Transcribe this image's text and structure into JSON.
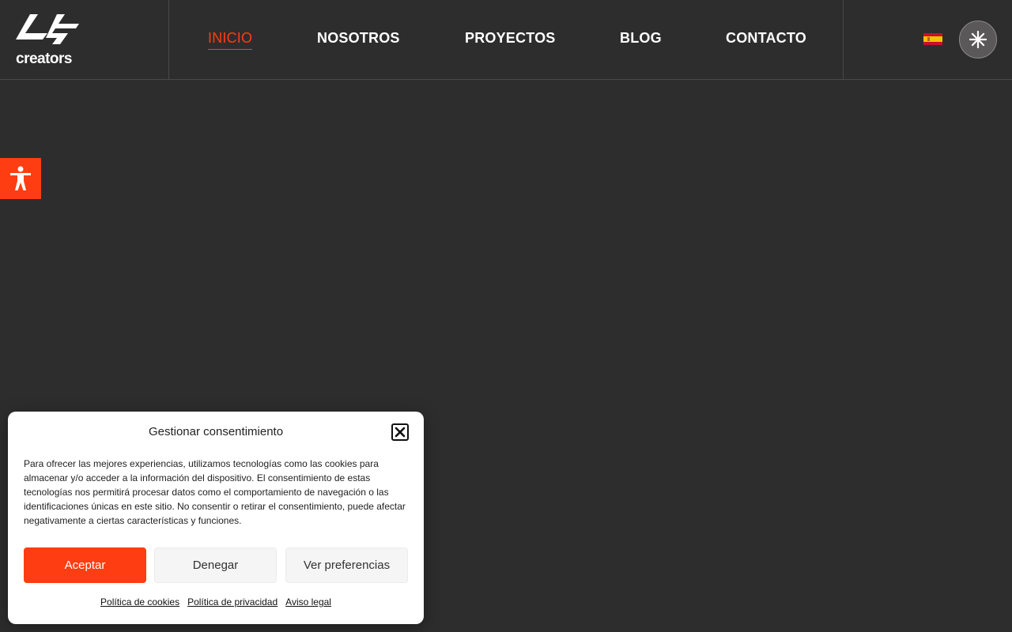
{
  "header": {
    "logo_text": "creators",
    "nav": [
      {
        "label": "INICIO",
        "active": true
      },
      {
        "label": "NOSOTROS"
      },
      {
        "label": "PROYECTOS"
      },
      {
        "label": "BLOG"
      },
      {
        "label": "CONTACTO"
      }
    ],
    "language_icon": "spain-flag-icon",
    "action_icon": "asterisk-icon"
  },
  "accessibility": {
    "icon": "accessibility-person-icon"
  },
  "cookie": {
    "title": "Gestionar consentimiento",
    "text": "Para ofrecer las mejores experiencias, utilizamos tecnologías como las cookies para almacenar y/o acceder a la información del dispositivo. El consentimiento de estas tecnologías nos permitirá procesar datos como el comportamiento de navegación o las identificaciones únicas en este sitio. No consentir o retirar el consentimiento, puede afectar negativamente a ciertas características y funciones.",
    "accept": "Aceptar",
    "deny": "Denegar",
    "preferences": "Ver preferencias",
    "links": [
      "Política de cookies",
      "Política de privacidad",
      "Aviso legal"
    ]
  },
  "colors": {
    "background": "#2e2d2d",
    "accent": "#ff3d12",
    "divider": "#4a4949"
  }
}
